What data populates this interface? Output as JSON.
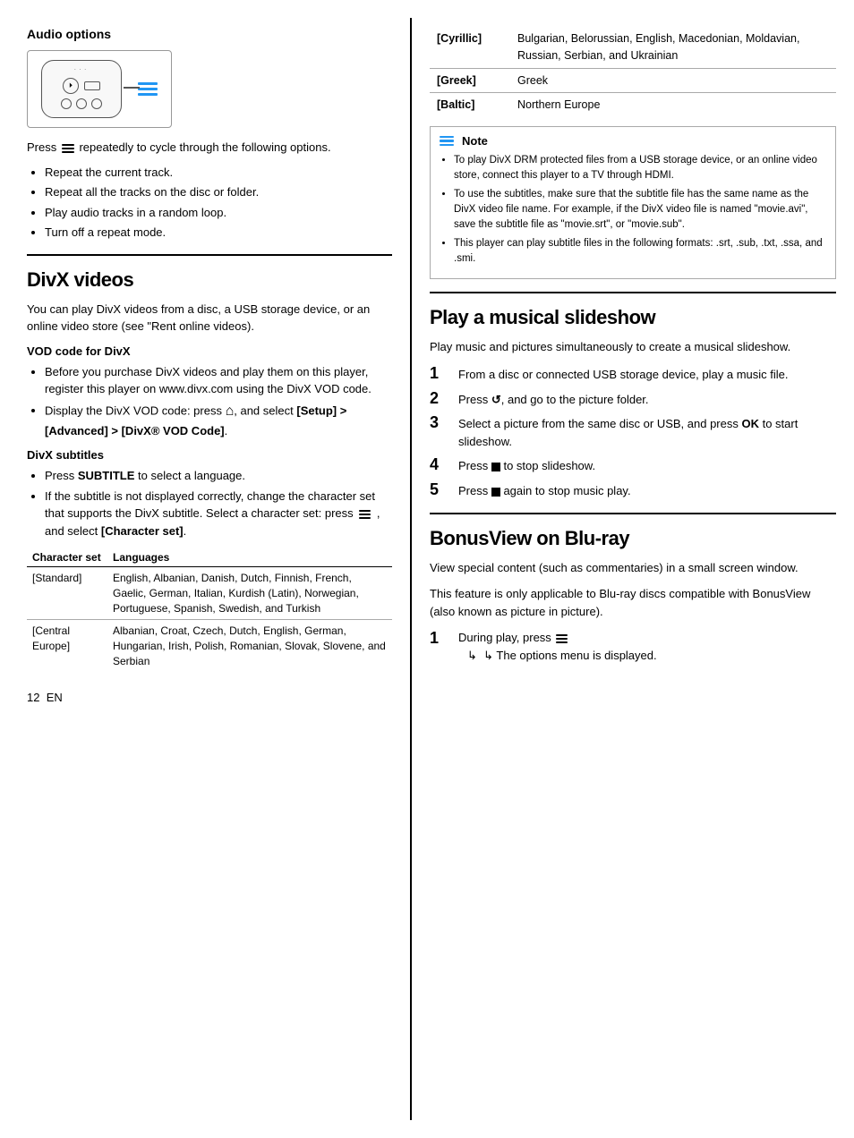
{
  "left": {
    "audio_options": {
      "title": "Audio options",
      "press_text_part1": "Press",
      "press_text_part2": "repeatedly to cycle through the following options.",
      "bullets": [
        "Repeat the current track.",
        "Repeat all the tracks on the disc or folder.",
        "Play audio tracks in a random loop.",
        "Turn off a repeat mode."
      ]
    },
    "divx_videos": {
      "title": "DivX videos",
      "intro": "You can play DivX videos from a disc, a USB storage device, or an online video store (see \"Rent online videos).",
      "vod_title": "VOD code for DivX",
      "vod_bullets": [
        "Before you purchase DivX videos and play them on this player, register this player on www.divx.com using the DivX VOD code.",
        "Display the DivX VOD code: press"
      ],
      "vod_bullet2_end": ", and select",
      "vod_bullet2_bold": "[Setup] > [Advanced] > [DivX® VOD Code]",
      "vod_bullet2_period": ".",
      "subtitle_title": "DivX subtitles",
      "subtitle_bullets": [
        "Press SUBTITLE to select a language.",
        "If the subtitle is not displayed correctly, change the character set that supports the DivX subtitle. Select a character set: press"
      ],
      "subtitle_bullet2_end": ", and select",
      "subtitle_bullet2_bold": "[Character set]",
      "subtitle_bullet2_period": ".",
      "table": {
        "col1": "Character set",
        "col2": "Languages",
        "rows": [
          {
            "char": "[Standard]",
            "lang": "English, Albanian, Danish, Dutch, Finnish, French, Gaelic, German, Italian, Kurdish (Latin), Norwegian, Portuguese, Spanish, Swedish, and Turkish"
          },
          {
            "char": "[Central Europe]",
            "lang": "Albanian, Croat, Czech, Dutch, English, German, Hungarian, Irish, Polish, Romanian, Slovak, Slovene, and Serbian"
          }
        ]
      }
    }
  },
  "right": {
    "table_rows": [
      {
        "char": "[Cyrillic]",
        "lang": "Bulgarian, Belorussian, English, Macedonian, Moldavian, Russian, Serbian, and Ukrainian"
      },
      {
        "char": "[Greek]",
        "lang": "Greek"
      },
      {
        "char": "[Baltic]",
        "lang": "Northern Europe"
      }
    ],
    "note": {
      "title": "Note",
      "bullets": [
        "To play DivX DRM protected files from a USB storage device, or an online video store, connect this player to a TV through HDMI.",
        "To use the subtitles, make sure that the subtitle file has the same name as the DivX video file name. For example, if the DivX video file is named \"movie.avi\", save the subtitle file as \"movie.srt\", or \"movie.sub\".",
        "This player can play subtitle files in the following formats: .srt, .sub, .txt, .ssa, and .smi."
      ]
    },
    "musical_slideshow": {
      "title": "Play a musical slideshow",
      "intro": "Play music and pictures simultaneously to create a musical slideshow.",
      "steps": [
        "From a disc or connected USB storage device, play a music file.",
        "Press ↩, and go to the picture folder.",
        "Select a picture from the same disc or USB, and press OK to start slideshow.",
        "Press ■ to stop slideshow.",
        "Press ■ again to stop music play."
      ]
    },
    "bonusview": {
      "title": "BonusView on Blu-ray",
      "intro1": "View special content (such as commentaries) in a small screen window.",
      "intro2": "This feature is only applicable to Blu-ray discs compatible with BonusView (also known as picture in picture).",
      "step1": "During play, press",
      "step1_arrow": "↳  The options menu is displayed."
    }
  },
  "footer": {
    "page_num": "12",
    "lang": "EN"
  }
}
